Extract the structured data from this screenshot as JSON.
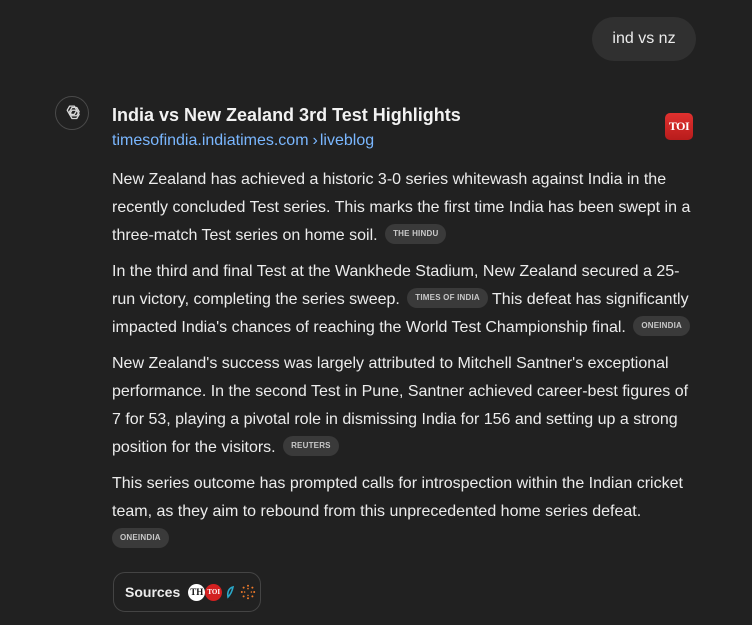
{
  "user_message": "ind vs nz",
  "answer": {
    "title": "India vs New Zealand 3rd Test Highlights",
    "source_domain": "timesofindia.indiatimes.com",
    "source_path": "liveblog",
    "source_logo_text": "TOI",
    "paragraphs": [
      {
        "text": "New Zealand has achieved a historic 3-0 series whitewash against India in the recently concluded Test series. This marks the first time India has been swept in a three-match Test series on home soil.",
        "cite": "THE HINDU"
      },
      {
        "text_a": "In the third and final Test at the Wankhede Stadium, New Zealand secured a 25-run victory, completing the series sweep.",
        "cite_a": "TIMES OF INDIA",
        "text_b": "This defeat has significantly impacted India's chances of reaching the World Test Championship final.",
        "cite_b": "ONEINDIA"
      },
      {
        "text": "New Zealand's success was largely attributed to Mitchell Santner's exceptional performance. In the second Test in Pune, Santner achieved career-best figures of 7 for 53, playing a pivotal role in dismissing India for 156 and setting up a strong position for the visitors.",
        "cite": "REUTERS"
      },
      {
        "text": "This series outcome has prompted calls for introspection within the Indian cricket team, as they aim to rebound from this unprecedented home series defeat.",
        "cite": "ONEINDIA"
      }
    ]
  },
  "sources": {
    "label": "Sources",
    "favicons": [
      {
        "icon": "the-hindu-favicon",
        "text": "TH"
      },
      {
        "icon": "toi-favicon",
        "text": "TOI"
      },
      {
        "icon": "oneindia-favicon"
      },
      {
        "icon": "reuters-favicon"
      }
    ]
  },
  "colors": {
    "background": "#212121",
    "user_bubble": "#303030",
    "link": "#7ab7ff",
    "citation_pill": "#3a3a3a",
    "toi_red": "#d32020"
  }
}
